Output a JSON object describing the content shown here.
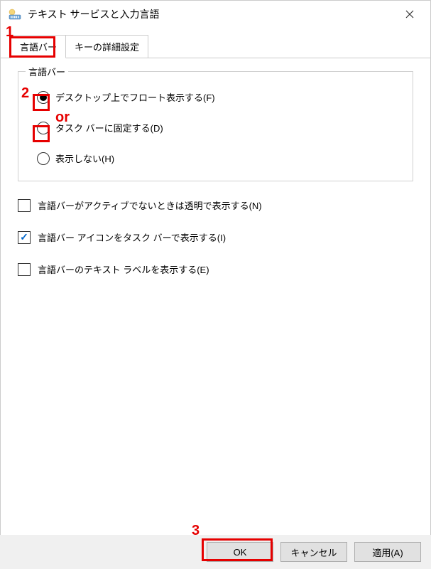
{
  "window": {
    "title": "テキスト サービスと入力言語"
  },
  "tabs": {
    "languageBar": "言語バー",
    "advancedKeySettings": "キーの詳細設定"
  },
  "fieldset": {
    "legend": "言語バー",
    "radioOptions": {
      "floatOnDesktop": "デスクトップ上でフロート表示する(F)",
      "dockInTaskbar": "タスク バーに固定する(D)",
      "hidden": "表示しない(H)"
    }
  },
  "checkboxes": {
    "transparentWhenInactive": "言語バーがアクティブでないときは透明で表示する(N)",
    "showIconInTaskbar": "言語バー アイコンをタスク バーで表示する(I)",
    "showTextLabels": "言語バーのテキスト ラベルを表示する(E)"
  },
  "buttons": {
    "ok": "OK",
    "cancel": "キャンセル",
    "apply": "適用(A)"
  },
  "annotations": {
    "n1": "1",
    "n2": "2",
    "n3": "3",
    "or": "or"
  }
}
